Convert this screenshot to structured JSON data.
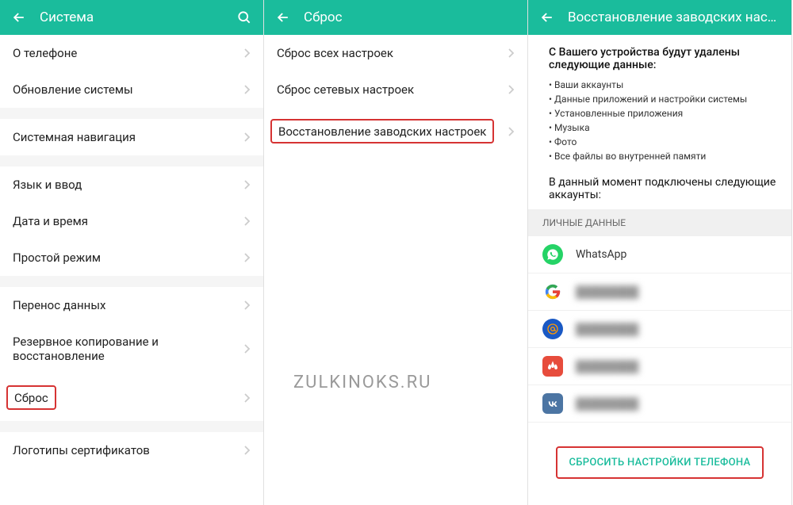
{
  "panel1": {
    "title": "Система",
    "items": [
      {
        "label": "О телефоне",
        "gap_after": false
      },
      {
        "label": "Обновление системы",
        "gap_after": true
      },
      {
        "label": "Системная навигация",
        "gap_after": true
      },
      {
        "label": "Язык и ввод",
        "gap_after": false
      },
      {
        "label": "Дата и время",
        "gap_after": false
      },
      {
        "label": "Простой режим",
        "gap_after": true
      },
      {
        "label": "Перенос данных",
        "gap_after": false
      },
      {
        "label": "Резервное копирование и восстановление",
        "gap_after": false
      },
      {
        "label": "Сброс",
        "gap_after": true,
        "highlight": true
      },
      {
        "label": "Логотипы сертификатов",
        "gap_after": false
      }
    ]
  },
  "panel2": {
    "title": "Сброс",
    "items": [
      {
        "label": "Сброс всех настроек"
      },
      {
        "label": "Сброс сетевых настроек"
      },
      {
        "label": "Восстановление заводских настроек",
        "highlight": true
      }
    ]
  },
  "panel3": {
    "title": "Восстановление заводских настроек",
    "intro": "С Вашего устройства будут удалены следующие данные:",
    "bullets": [
      "Ваши аккаунты",
      "Данные приложений и настройки системы",
      "Установленные приложения",
      "Музыка",
      "Фото",
      "Все файлы во внутренней памяти"
    ],
    "note": "В данный момент подключены следующие аккаунты:",
    "section_header": "ЛИЧНЫЕ ДАННЫЕ",
    "accounts": [
      {
        "name": "WhatsApp",
        "icon": "whatsapp",
        "blurred": false
      },
      {
        "name": "account hidden",
        "icon": "google",
        "blurred": true
      },
      {
        "name": "account hidden",
        "icon": "mail",
        "blurred": true
      },
      {
        "name": "account hidden",
        "icon": "huawei",
        "blurred": true
      },
      {
        "name": "account hidden",
        "icon": "vk",
        "blurred": true
      }
    ],
    "reset_button": "СБРОСИТЬ НАСТРОЙКИ ТЕЛЕФОНА"
  },
  "watermark": "ZULKINOKS.RU"
}
